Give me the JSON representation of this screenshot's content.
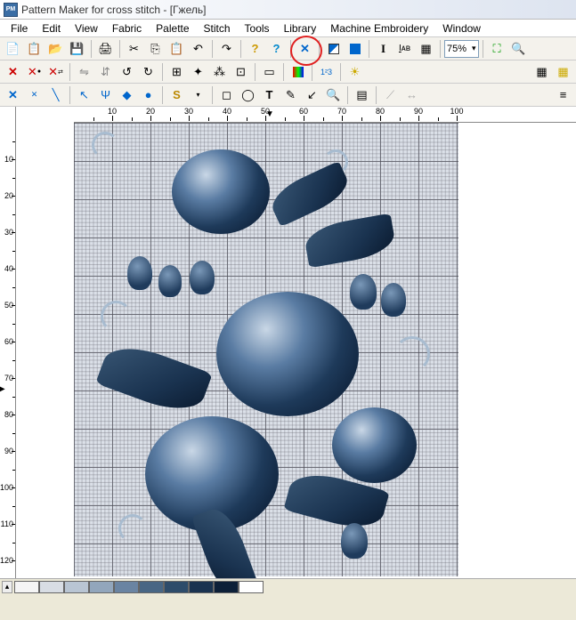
{
  "title": "Pattern Maker for cross stitch - [Гжель]",
  "menu": [
    "File",
    "Edit",
    "View",
    "Fabric",
    "Palette",
    "Stitch",
    "Tools",
    "Library",
    "Machine Embroidery",
    "Window"
  ],
  "zoom": "75%",
  "ruler_h": [
    10,
    20,
    30,
    40,
    50,
    60,
    70,
    80,
    90,
    100
  ],
  "ruler_v": [
    10,
    20,
    30,
    40,
    50,
    60,
    70,
    80,
    90,
    100,
    110,
    120
  ],
  "palette": [
    "#f5f5f5",
    "#d8dde4",
    "#b9c5d3",
    "#92a6bc",
    "#6a84a2",
    "#486684",
    "#2e4c6a",
    "#1a3350",
    "#0d2038",
    "#ffffff"
  ],
  "toolbar1_icons": [
    "new-icon",
    "paste-special-icon",
    "open-icon",
    "save-icon",
    "print-icon",
    "cut-icon",
    "copy-icon",
    "paste-icon",
    "undo-icon",
    "redo-icon",
    "help-icon",
    "about-icon",
    "full-stitch-icon",
    "half-stitch-icon",
    "quarter-stitch-icon",
    "back-stitch-icon",
    "text-icon",
    "text-underline-icon",
    "grid-display-icon",
    "zoom-fit-icon",
    "zoom-tool-icon"
  ],
  "toolbar2_icons": [
    "delete-stitch-icon",
    "erase-color-icon",
    "swap-color-icon",
    "flip-h-icon",
    "flip-v-icon",
    "rotate-ccw-icon",
    "rotate-cw-icon",
    "align-icon",
    "center-icon",
    "distribute-icon",
    "snap-icon",
    "select-rect-icon",
    "select-free-icon",
    "color-picker-icon",
    "numbers-icon",
    "highlight-icon",
    "grid-toggle-icon",
    "grid-snap-icon"
  ],
  "toolbar3_icons": [
    "x-stitch-icon",
    "petite-x-icon",
    "back-line-icon",
    "arrow-nw-icon",
    "arrow-ne-icon",
    "knot-icon",
    "bead-icon",
    "special-s-icon",
    "dropdown-icon",
    "sel-rect-icon",
    "sel-ellipse-icon",
    "text-t-icon",
    "pen-icon",
    "picker-icon",
    "magnify-icon",
    "library-icon",
    "ruler-icon",
    "measure-icon",
    "thread-icon"
  ]
}
